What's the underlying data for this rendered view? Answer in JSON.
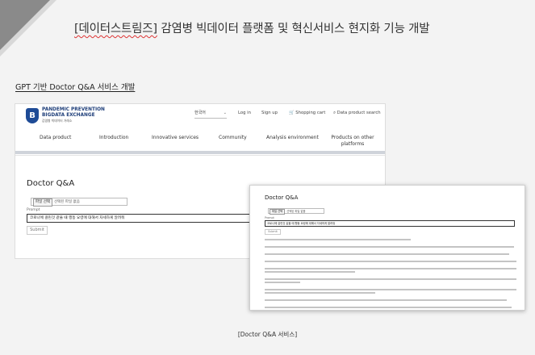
{
  "slide": {
    "title_brand": "[데이터스트림즈]",
    "title_rest": " 감염병 빅데이터 플랫폼 및 혁신서비스 현지화 기능 개발",
    "section_label": "GPT 기반 Doctor Q&A 서비스 개발",
    "caption": "[Doctor Q&A 서비스]"
  },
  "site": {
    "logo_glyph": "B",
    "logo_line1": "PANDEMIC PREVENTION",
    "logo_line2": "BIGDATA EXCHANGE",
    "logo_line3": "감염병 빅데이터 거래소",
    "language": "한국어",
    "login": "Log in",
    "signup": "Sign up",
    "cart": "Shopping cart",
    "search": "Data product search",
    "nav": [
      "Data product",
      "Introduction",
      "Innovative services",
      "Community",
      "Analysis environment",
      "Products on other platforms"
    ]
  },
  "doctor_qa": {
    "title": "Doctor Q&A",
    "file_button": "파일 선택",
    "file_status": "선택된 파일 없음",
    "prompt_label": "Prompt",
    "prompt_value": "코로나에 걸린것 같을 때 행동 요령에 대해서 자세하게 알려줘",
    "submit": "Submit"
  }
}
